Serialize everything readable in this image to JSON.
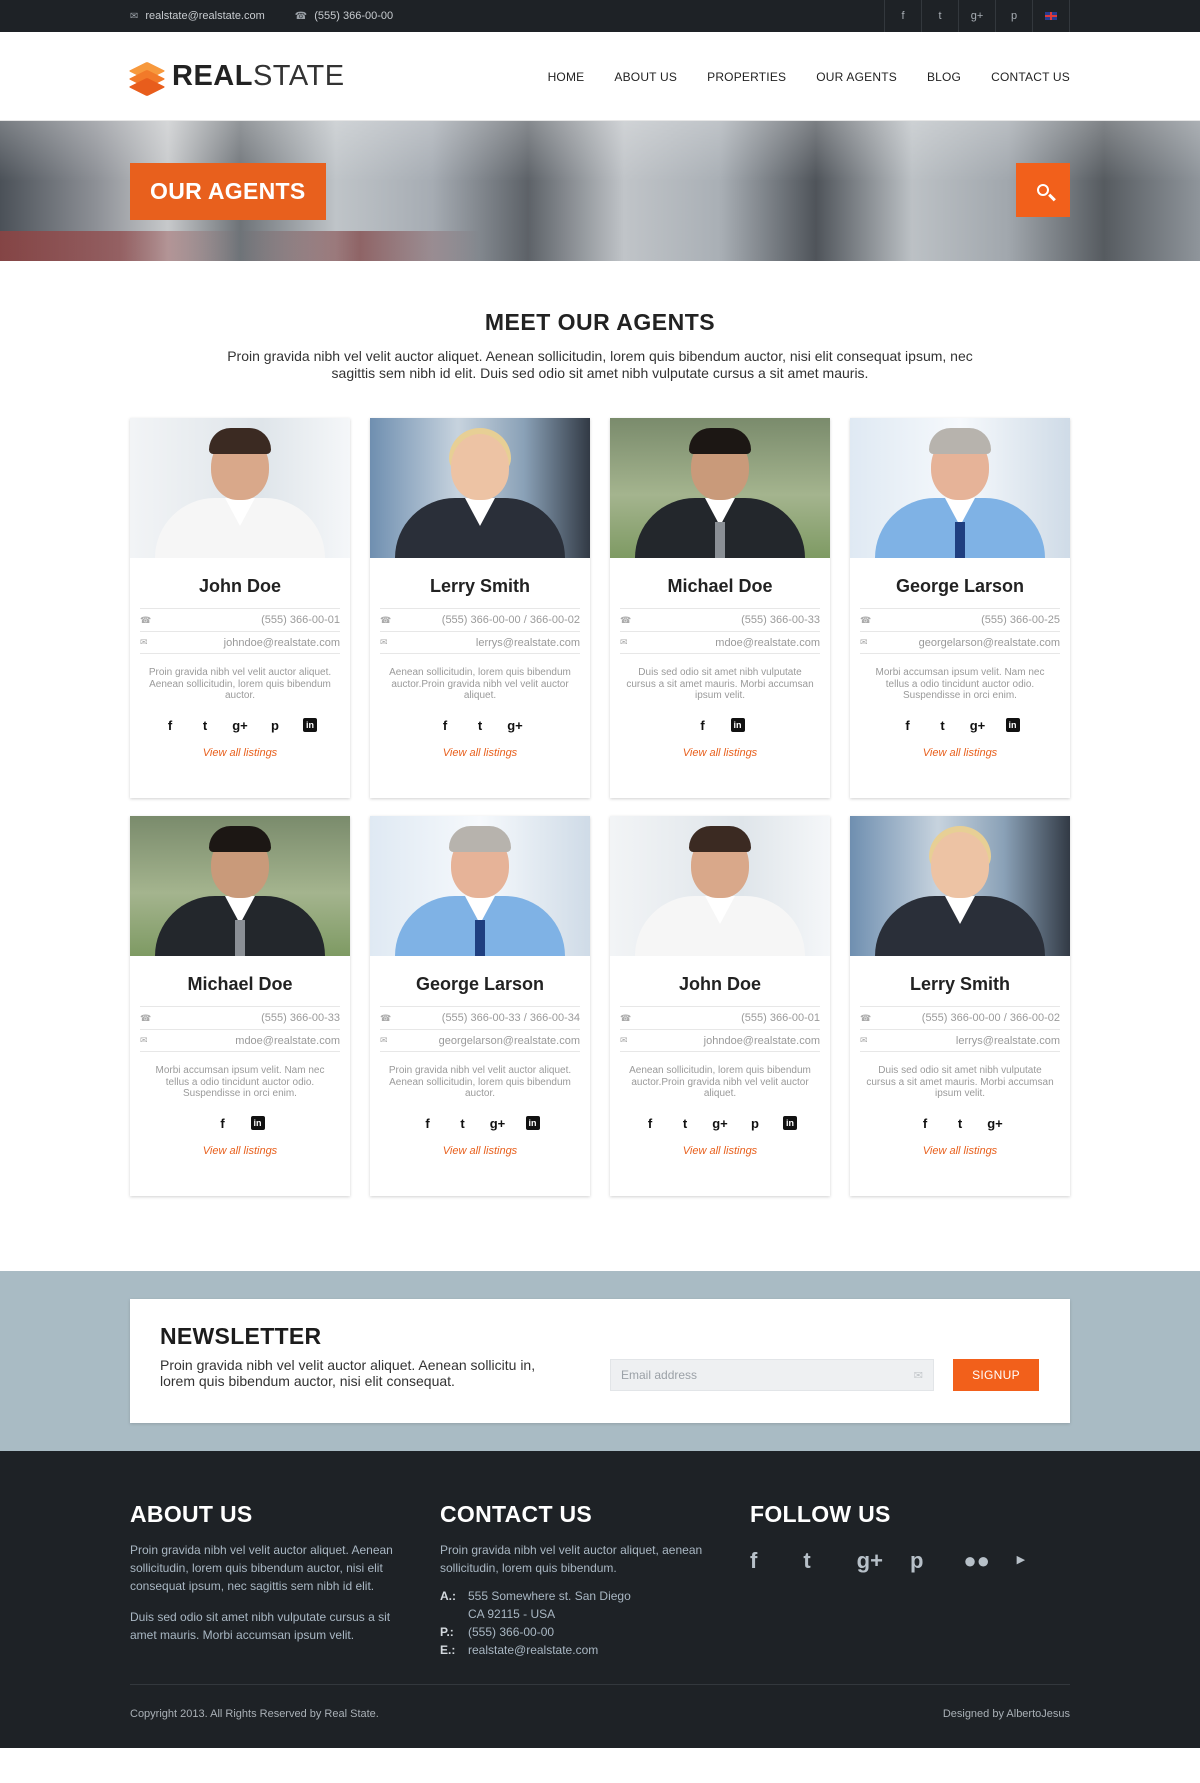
{
  "topbar": {
    "email": "realstate@realstate.com",
    "phone": "(555) 366-00-00"
  },
  "logo": {
    "bold": "REAL",
    "light": "STATE"
  },
  "nav": [
    "HOME",
    "ABOUT US",
    "PROPERTIES",
    "OUR AGENTS",
    "BLOG",
    "CONTACT US"
  ],
  "banner": {
    "title": "OUR AGENTS"
  },
  "intro": {
    "title": "MEET OUR AGENTS",
    "text": "Proin gravida nibh vel velit auctor aliquet. Aenean sollicitudin, lorem quis bibendum auctor, nisi elit consequat ipsum, nec sagittis sem nibh id elit. Duis sed odio sit amet nibh vulputate cursus a sit amet mauris."
  },
  "agents": [
    {
      "name": "John Doe",
      "phone": "(555) 366-00-01",
      "email": "johndoe@realstate.com",
      "desc": "Proin gravida nibh vel velit auctor aliquet. Aenean sollicitudin, lorem quis bibendum auctor.",
      "link": "View all listings"
    },
    {
      "name": "Lerry Smith",
      "phone": "(555) 366-00-00 / 366-00-02",
      "email": "lerrys@realstate.com",
      "desc": "Aenean sollicitudin, lorem quis bibendum auctor.Proin gravida nibh vel velit auctor aliquet.",
      "link": "View all listings"
    },
    {
      "name": "Michael Doe",
      "phone": "(555) 366-00-33",
      "email": "mdoe@realstate.com",
      "desc": "Duis sed odio sit amet nibh vulputate cursus a sit amet mauris. Morbi accumsan ipsum velit.",
      "link": "View all listings"
    },
    {
      "name": "George Larson",
      "phone": "(555) 366-00-25",
      "email": "georgelarson@realstate.com",
      "desc": "Morbi accumsan ipsum velit. Nam nec tellus a odio tincidunt auctor odio. Suspendisse in orci enim.",
      "link": "View all listings"
    },
    {
      "name": "Michael Doe",
      "phone": "(555) 366-00-33",
      "email": "mdoe@realstate.com",
      "desc": "Morbi accumsan ipsum velit. Nam nec tellus a odio tincidunt auctor odio. Suspendisse in orci enim.",
      "link": "View all listings"
    },
    {
      "name": "George Larson",
      "phone": "(555) 366-00-33 / 366-00-34",
      "email": "georgelarson@realstate.com",
      "desc": "Proin gravida nibh vel velit auctor aliquet. Aenean sollicitudin, lorem quis bibendum auctor.",
      "link": "View all listings"
    },
    {
      "name": "John Doe",
      "phone": "(555) 366-00-01",
      "email": "johndoe@realstate.com",
      "desc": "Aenean sollicitudin, lorem quis bibendum auctor.Proin gravida nibh vel velit auctor aliquet.",
      "link": "View all listings"
    },
    {
      "name": "Lerry Smith",
      "phone": "(555) 366-00-00 / 366-00-02",
      "email": "lerrys@realstate.com",
      "desc": "Duis sed odio sit amet nibh vulputate cursus a sit amet mauris. Morbi accumsan ipsum velit.",
      "link": "View all listings"
    }
  ],
  "newsletter": {
    "title": "NEWSLETTER",
    "text": "Proin gravida nibh vel velit auctor aliquet. Aenean sollicitu in, lorem quis bibendum auctor, nisi elit consequat.",
    "placeholder": "Email address",
    "button": "SIGNUP"
  },
  "footer": {
    "about": {
      "title": "ABOUT US",
      "p1": "Proin gravida nibh vel velit auctor aliquet. Aenean sollicitudin, lorem quis bibendum auctor, nisi elit consequat ipsum, nec sagittis sem nibh id elit.",
      "p2": "Duis sed odio sit amet nibh vulputate cursus a sit amet mauris. Morbi accumsan ipsum velit."
    },
    "contact": {
      "title": "CONTACT US",
      "text": "Proin gravida nibh vel velit auctor aliquet, aenean sollicitudin, lorem quis bibendum.",
      "a_label": "A.:",
      "address1": "555 Somewhere st. San Diego",
      "address2": "CA 92115 - USA",
      "p_label": "P.:",
      "phone": "(555) 366-00-00",
      "e_label": "E.:",
      "email": "realstate@realstate.com"
    },
    "follow": {
      "title": "FOLLOW US"
    },
    "copyright": "Copyright 2013. All Rights Reserved by Real State.",
    "designed": "Designed by AlbertoJesus"
  },
  "colors": {
    "accent": "#f2601b",
    "dark": "#1e2226",
    "newsletter_bg": "#a9bbc4"
  },
  "icons": {
    "topbar_social": [
      "facebook-icon",
      "twitter-icon",
      "google-plus-icon",
      "pinterest-icon",
      "uk-flag-icon"
    ],
    "follow": [
      "facebook-icon",
      "twitter-icon",
      "google-plus-icon",
      "pinterest-icon",
      "flickr-icon",
      "youtube-icon"
    ]
  }
}
